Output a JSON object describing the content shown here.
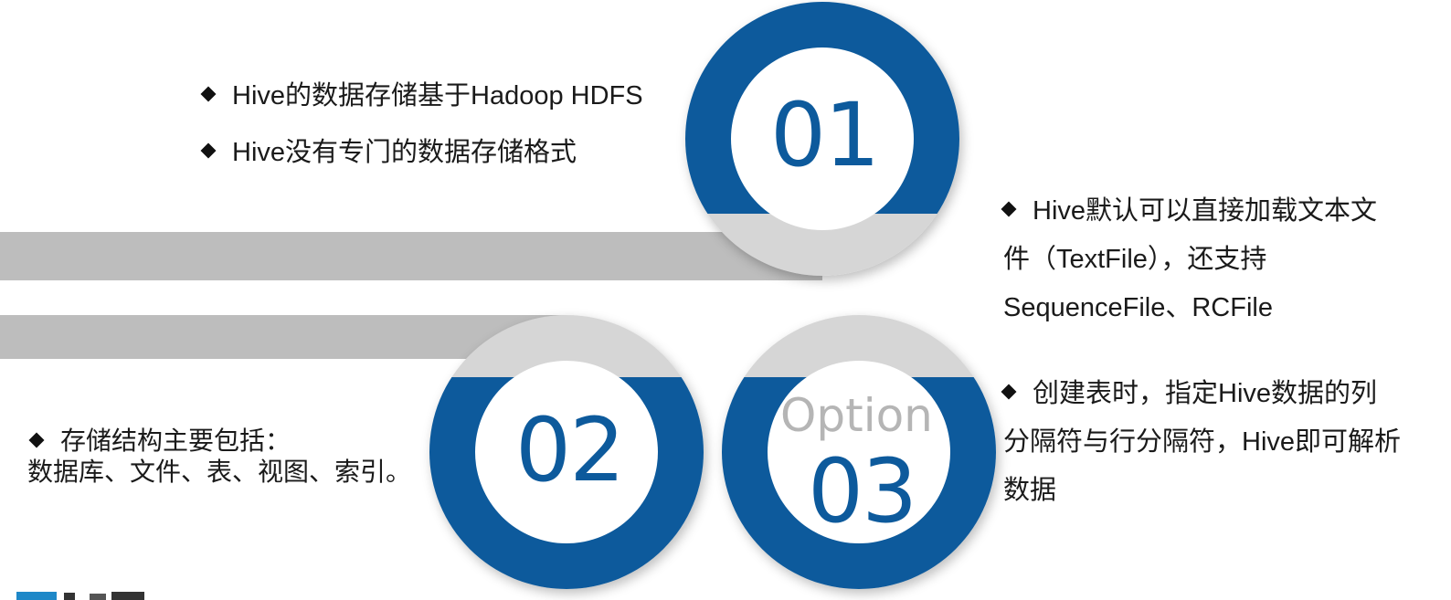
{
  "colors": {
    "ring_blue": "#0d5a9c",
    "ring_grey": "#d6d6d6",
    "bar_grey": "#bdbdbd",
    "number_blue": "#0d5a9c",
    "option_grey": "#b5b5b5"
  },
  "items": [
    {
      "number": "01",
      "bullets": [
        "Hive的数据存储基于Hadoop HDFS",
        "Hive没有专门的数据存储格式"
      ]
    },
    {
      "number": "02",
      "bullets": [
        "存储结构主要包括："
      ],
      "continuation": "数据库、文件、表、视图、索引。"
    },
    {
      "label": "Option",
      "number": "03"
    }
  ],
  "right_notes": {
    "note1_lines": [
      "Hive默认可以直接加载文本文",
      "件（TextFile），还支持",
      "SequenceFile、RCFile"
    ],
    "note2_lines": [
      "创建表时，指定Hive数据的列",
      "分隔符与行分隔符，Hive即可解析",
      "数据"
    ]
  }
}
